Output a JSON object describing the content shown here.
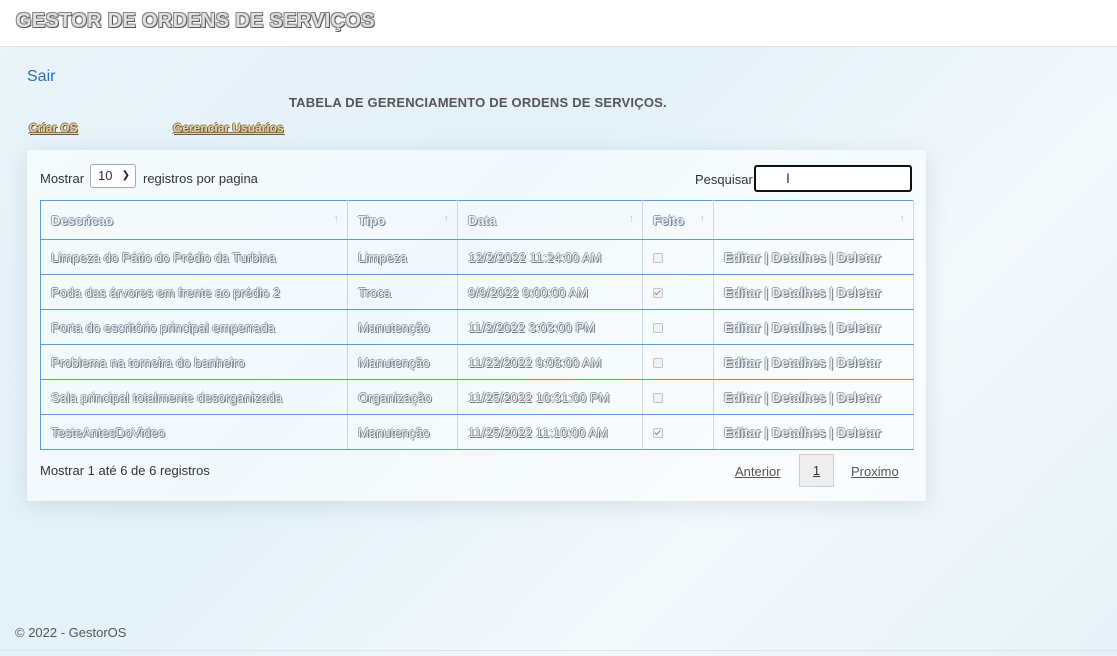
{
  "header": {
    "brand": "GESTOR DE ORDENS DE SERVIÇOS"
  },
  "nav": {
    "logout": "Sair",
    "create_os": "Criar OS",
    "manage_users": "Gerenciar Usuários"
  },
  "page": {
    "title": "TABELA DE GERENCIAMENTO DE ORDENS DE SERVIÇOS."
  },
  "datatable": {
    "show_label": "Mostrar",
    "page_size": "10",
    "per_page_label": "registros por pagina",
    "search_label": "Pesquisar",
    "search_value": "",
    "columns": [
      "Descricao",
      "Tipo",
      "Data",
      "Feito",
      ""
    ],
    "rows": [
      {
        "descricao": "Limpeza do Pátio do Prédio da Turbina",
        "tipo": "Limpeza",
        "data": "12/2/2022 11:24:00 AM",
        "feito": false
      },
      {
        "descricao": "Poda das árvores em frente ao prédio 2",
        "tipo": "Troca",
        "data": "9/9/2022 9:00:00 AM",
        "feito": true
      },
      {
        "descricao": "Porta do escritório principal emperrada",
        "tipo": "Manutenção",
        "data": "11/2/2022 3:03:00 PM",
        "feito": false
      },
      {
        "descricao": "Problema na torneira do banheiro",
        "tipo": "Manutenção",
        "data": "11/22/2022 9:08:00 AM",
        "feito": false
      },
      {
        "descricao": "Sala principal totalmente desorganizada",
        "tipo": "Organização",
        "data": "11/25/2022 10:31:00 PM",
        "feito": false
      },
      {
        "descricao": "TesteAntesDoVideo",
        "tipo": "Manutenção",
        "data": "11/25/2022 11:10:00 AM",
        "feito": true
      }
    ],
    "actions": {
      "edit": "Editar",
      "details": "Detalhes",
      "delete": "Deletar",
      "separator": " | "
    },
    "info": "Mostrar 1 até 6 de 6 registros",
    "pagination": {
      "previous": "Anterior",
      "current": "1",
      "next": "Proximo"
    }
  },
  "footer": {
    "text": "© 2022 - GestorOS"
  }
}
